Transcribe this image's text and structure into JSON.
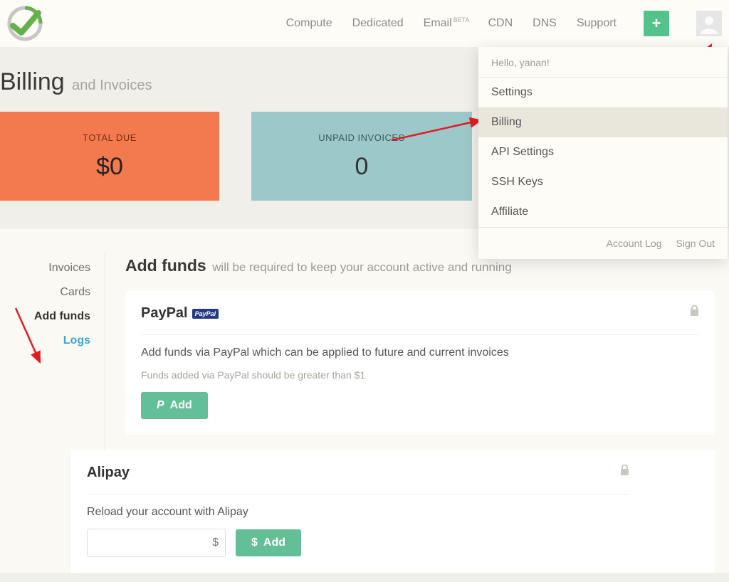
{
  "header": {
    "nav": {
      "compute": "Compute",
      "dedicated": "Dedicated",
      "email": "Email",
      "email_badge": "BETA",
      "cdn": "CDN",
      "dns": "DNS",
      "support": "Support"
    }
  },
  "dropdown": {
    "hello": "Hello, yanan!",
    "items": {
      "settings": "Settings",
      "billing": "Billing",
      "api": "API Settings",
      "ssh": "SSH Keys",
      "affiliate": "Affiliate"
    },
    "footer": {
      "account_log": "Account Log",
      "sign_out": "Sign Out"
    }
  },
  "page": {
    "title": "Billing",
    "subtitle": "and Invoices"
  },
  "stats": {
    "total_due": {
      "label": "TOTAL DUE",
      "value": "$0"
    },
    "unpaid": {
      "label": "UNPAID INVOICES",
      "value": "0"
    }
  },
  "sidebar": {
    "invoices": "Invoices",
    "cards": "Cards",
    "addfunds": "Add funds",
    "logs": "Logs"
  },
  "addfunds": {
    "title": "Add funds",
    "subtitle": "will be required to keep your account active and running",
    "paypal": {
      "title": "PayPal",
      "badge": "PayPal",
      "desc": "Add funds via PayPal which can be applied to future and current invoices",
      "note": "Funds added via PayPal should be greater than $1",
      "btn": "Add"
    },
    "alipay": {
      "title": "Alipay",
      "desc": "Reload your account with Alipay",
      "currency": "$",
      "btn": "Add"
    }
  }
}
